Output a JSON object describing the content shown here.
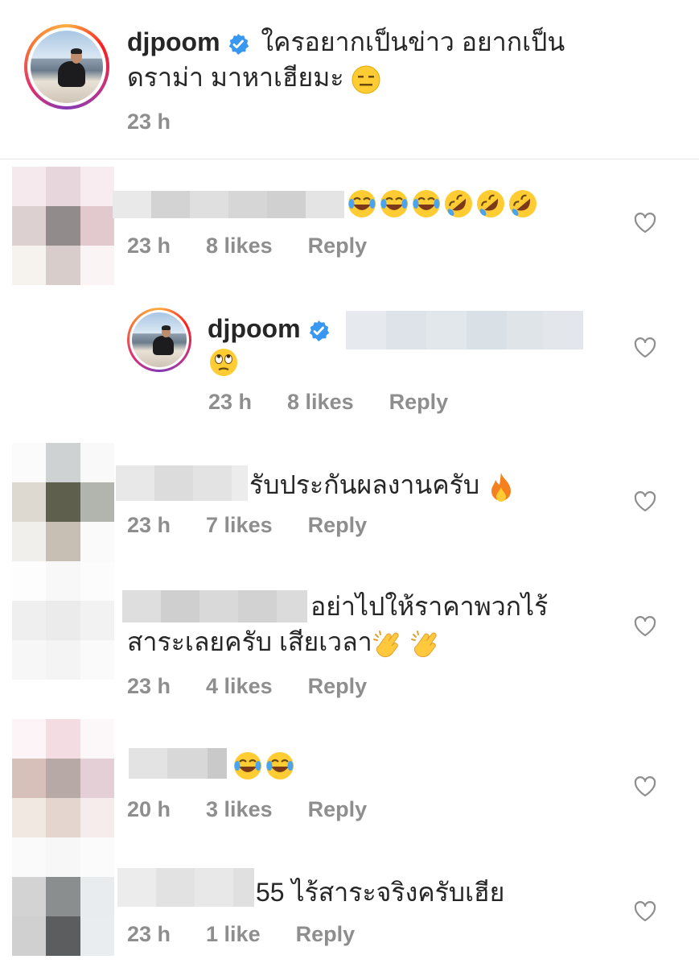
{
  "caption": {
    "username": "djpoom",
    "line1": "ใครอยากเป็นข่าว อยากเป็น",
    "line2": "ดราม่า มาหาเฮียมะ",
    "emoji": "expressionless-face",
    "time": "23 h"
  },
  "comments": [
    {
      "text": "",
      "emojis": [
        "joy",
        "joy",
        "joy",
        "rofl",
        "rofl",
        "rofl"
      ],
      "time": "23 h",
      "likes": "8 likes",
      "reply": "Reply"
    },
    {
      "username": "djpoom",
      "emoji": "rolling-eyes",
      "time": "23 h",
      "likes": "8 likes",
      "reply": "Reply",
      "is_reply": true
    },
    {
      "text": "รับประกันผลงานครับ",
      "emojis": [
        "fire"
      ],
      "time": "23 h",
      "likes": "7 likes",
      "reply": "Reply"
    },
    {
      "line1": "อย่าไปให้ราคาพวกไร้",
      "line2": "สาระเลยครับ เสียเวลา",
      "emojis": [
        "clap",
        "clap"
      ],
      "time": "23 h",
      "likes": "4 likes",
      "reply": "Reply"
    },
    {
      "text": "",
      "emojis": [
        "joy",
        "joy"
      ],
      "time": "20 h",
      "likes": "3 likes",
      "reply": "Reply"
    },
    {
      "text": "55 ไร้สาระจริงครับเฮีย",
      "time": "23 h",
      "likes": "1 like",
      "reply": "Reply"
    }
  ],
  "colors": {
    "verified": "#3897f0",
    "meta": "#8e8e8e",
    "text": "#262626"
  }
}
